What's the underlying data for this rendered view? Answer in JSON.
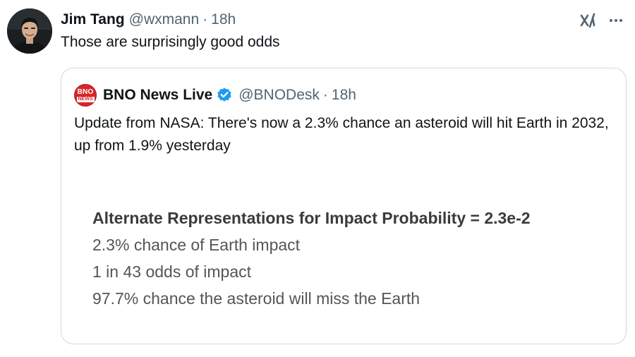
{
  "author": {
    "name": "Jim Tang",
    "handle": "@wxmann",
    "separator": "·",
    "time": "18h",
    "text": "Those are surprisingly good odds"
  },
  "icons": {
    "grok": "grok-icon",
    "more": "more-icon",
    "verified_color": "#1d9bf0"
  },
  "quoted": {
    "logo_line1": "BNO",
    "logo_line2": "NEWS",
    "name": "BNO News Live",
    "handle": "@BNODesk",
    "separator": "·",
    "time": "18h",
    "text": "Update from NASA: There's now a 2.3% chance an asteroid will hit Earth in 2032, up from 1.9% yesterday",
    "media": {
      "title": "Alternate Representations for Impact Probability = 2.3e-2",
      "rows": [
        "2.3% chance of Earth impact",
        "1 in 43 odds of impact",
        "97.7% chance the asteroid will miss the Earth"
      ]
    }
  }
}
